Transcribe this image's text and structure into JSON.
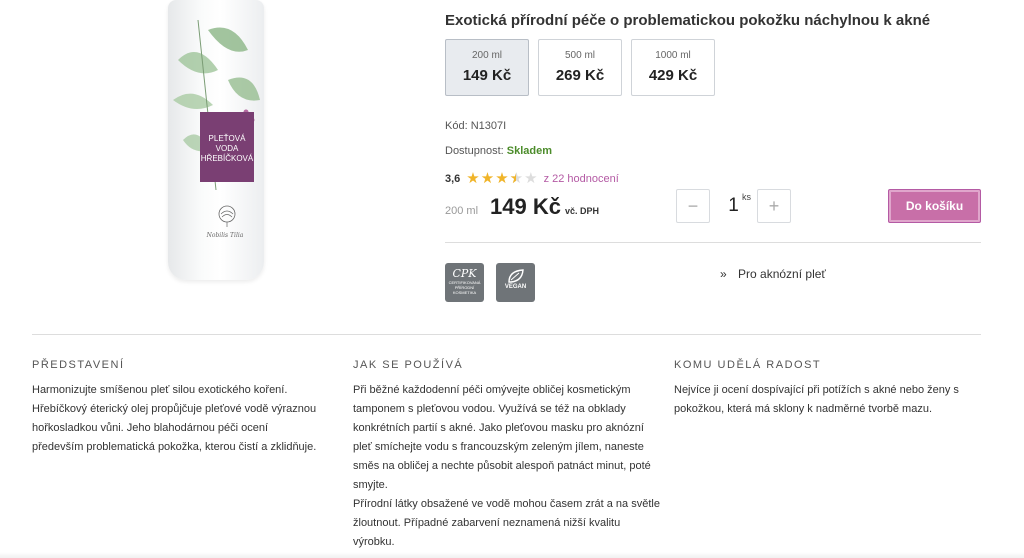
{
  "product": {
    "title": "Exotická přírodní péče o problematickou pokožku náchylnou k akné",
    "bottle_label_line1": "PLEŤOVÁ",
    "bottle_label_line2": "VODA",
    "bottle_label_line3": "HŘEBÍČKOVÁ",
    "bottle_brand": "Nobilis Tilia"
  },
  "variants": [
    {
      "volume": "200 ml",
      "price": "149 Kč",
      "selected": true
    },
    {
      "volume": "500 ml",
      "price": "269 Kč",
      "selected": false
    },
    {
      "volume": "1000 ml",
      "price": "429 Kč",
      "selected": false
    }
  ],
  "meta": {
    "code_label": "Kód:",
    "code_value": "N1307I",
    "stock_label": "Dostupnost:",
    "stock_value": "Skladem"
  },
  "rating": {
    "score": "3,6",
    "stars_value": 3.6,
    "count_text": "z 22 hodnocení"
  },
  "price": {
    "unit": "200 ml",
    "amount": "149 Kč",
    "vat": "vč. DPH"
  },
  "quantity": {
    "minus": "−",
    "value": "1",
    "unit": "ks",
    "plus": "+"
  },
  "cart_button": "Do košíku",
  "badges": {
    "cpk_title": "CPK",
    "cpk_sub": "CERTIFIKOVANÁ PŘÍRODNÍ KOSMETIKA",
    "vegan": "VEGAN"
  },
  "link": {
    "chevron": "»",
    "label": "Pro aknózní pleť"
  },
  "sections": [
    {
      "heading": "PŘEDSTAVENÍ",
      "text": "Harmonizujte smíšenou pleť silou exotického koření. Hřebíčkový éterický olej propůjčuje pleťové vodě výraznou hořkosladkou vůni. Jeho blahodárnou péči ocení především problematická pokožka, kterou čistí a zklidňuje."
    },
    {
      "heading": "JAK SE POUŽÍVÁ",
      "text": "Při běžné každodenní péči omývejte obličej kosmetickým tamponem s pleťovou vodou. Využívá se též na obklady konkrétních partií s akné. Jako pleťovou masku pro aknózní pleť smíchejte vodu s francouzským zeleným jílem, naneste směs na obličej a nechte působit alespoň patnáct minut, poté smyjte.",
      "text2": "Přírodní látky obsažené ve vodě mohou časem zrát a na světle žloutnout. Případné zabarvení neznamená nižší kvalitu výrobku."
    },
    {
      "heading": "KOMU UDĚLÁ RADOST",
      "text": "Nejvíce ji ocení dospívající při potížích s akné nebo ženy s pokožkou, která má sklony k nadměrné tvorbě mazu."
    }
  ],
  "colors": {
    "accent": "#c86fa8",
    "in_stock": "#4c8c2b",
    "star": "#f0b429",
    "label_purple": "#7a3f73"
  }
}
